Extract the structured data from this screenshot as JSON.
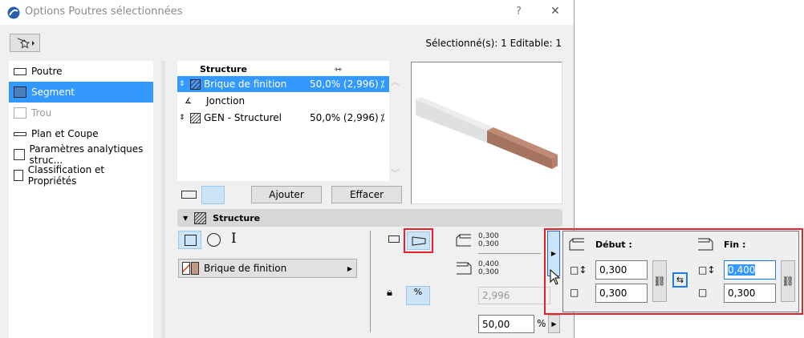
{
  "window": {
    "title": "Options Poutres sélectionnées",
    "help": "?",
    "close": "✕"
  },
  "selection_info": "Sélectionné(s): 1 Editable: 1",
  "sidebar": {
    "items": [
      {
        "label": "Poutre",
        "icon": "beam-icon",
        "selected": false,
        "disabled": false
      },
      {
        "label": "Segment",
        "icon": "segment-icon",
        "selected": true,
        "disabled": false
      },
      {
        "label": "Trou",
        "icon": "hole-icon",
        "selected": false,
        "disabled": true
      },
      {
        "label": "Plan et Coupe",
        "icon": "plan-section-icon",
        "selected": false,
        "disabled": false
      },
      {
        "label": "Paramètres analytiques struc...",
        "icon": "analytic-icon",
        "selected": false,
        "disabled": false
      },
      {
        "label": "Classification et Propriétés",
        "icon": "document-icon",
        "selected": false,
        "disabled": false
      }
    ]
  },
  "segments": {
    "header": "Structure",
    "rows": [
      {
        "name": "Brique de finition",
        "value": "50,0% (2,996)",
        "selected": true
      },
      {
        "name": "Jonction",
        "value": ""
      },
      {
        "name": "GEN - Structurel",
        "value": "50,0% (2,996)",
        "selected": false
      }
    ],
    "add": "Ajouter",
    "delete": "Effacer"
  },
  "structure": {
    "title": "Structure",
    "material": "Brique de finition",
    "start_values": [
      "0,300",
      "0,300"
    ],
    "end_values": [
      "0,400",
      "0,300"
    ],
    "length": "2,996",
    "percent": "50,00",
    "percent_unit": "%"
  },
  "popup": {
    "start_label": "Début :",
    "end_label": "Fin :",
    "start_height": "0,300",
    "start_width": "0,300",
    "end_height": "0,400",
    "end_width": "0,300"
  },
  "colors": {
    "accent": "#3399ff",
    "highlight": "#cce4f7",
    "brick": "#b0826c",
    "red": "#e8202a"
  }
}
